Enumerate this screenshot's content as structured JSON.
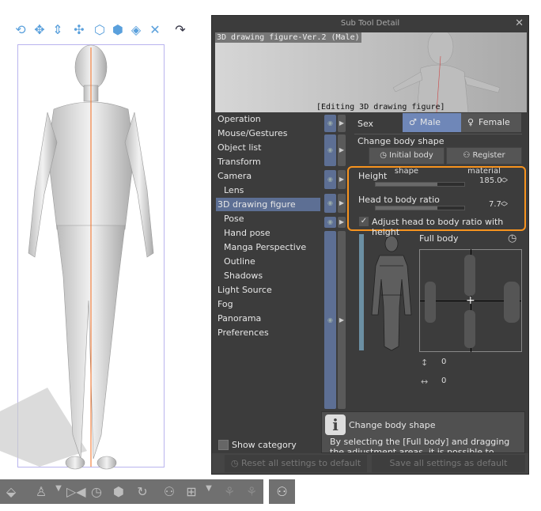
{
  "canvas_toolbar": {
    "icons": [
      "rotate-camera-icon",
      "pan-camera-icon",
      "zoom-camera-icon",
      "move-object-icon",
      "rotate-object-icon",
      "rotate-object-x-icon",
      "rotate-object-y-icon",
      "move-ground-icon",
      "snap-icon"
    ]
  },
  "dialog": {
    "title": "Sub Tool Detail",
    "preview_title": "3D drawing figure-Ver.2 (Male)",
    "editing_label": "[Editing 3D drawing figure]",
    "menu": [
      {
        "label": "Operation"
      },
      {
        "label": "Mouse/Gestures"
      },
      {
        "label": "Object list"
      },
      {
        "label": "Transform"
      },
      {
        "label": "Camera"
      },
      {
        "label": "Lens",
        "sub": true
      },
      {
        "label": "3D drawing figure",
        "selected": true
      },
      {
        "label": "Pose",
        "sub": true
      },
      {
        "label": "Hand pose",
        "sub": true
      },
      {
        "label": "Manga Perspective",
        "sub": true
      },
      {
        "label": "Outline",
        "sub": true
      },
      {
        "label": "Shadows",
        "sub": true
      },
      {
        "label": "Light Source"
      },
      {
        "label": "Fog"
      },
      {
        "label": "Panorama"
      },
      {
        "label": "Preferences"
      }
    ],
    "show_category": "Show category",
    "sex_label": "Sex",
    "sex_options": [
      "Male",
      "Female"
    ],
    "sex_selected": "Male",
    "change_body_shape": "Change body shape",
    "initial_body_shape": "Initial body shape",
    "register_material": "Register material",
    "height": {
      "label": "Height",
      "value": "185.0",
      "fraction": 0.7
    },
    "ratio": {
      "label": "Head to body ratio",
      "value": "7.7",
      "fraction": 0.7
    },
    "adjust_checkbox": {
      "label": "Adjust head to body ratio with height",
      "checked": true
    },
    "full_body": "Full body",
    "vertical_value": "0",
    "horizontal_value": "0",
    "info_title": "Change body shape",
    "info_text": "By selecting the [Full body] and dragging the adjustment areas, it is possible to change the",
    "reset_button": "Reset all settings to default",
    "save_button": "Save all settings as default",
    "accent": "#f7931e"
  }
}
